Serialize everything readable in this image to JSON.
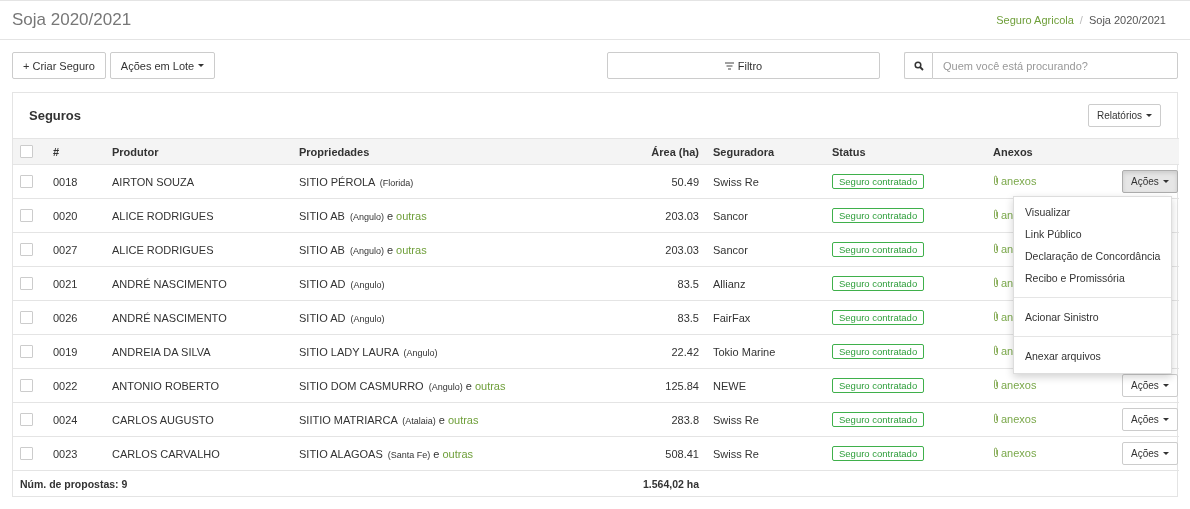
{
  "page_title": "Soja 2020/2021",
  "breadcrumb": [
    {
      "label": "Seguro Agricola",
      "link": true
    },
    {
      "label": "Soja 2020/2021",
      "link": false
    }
  ],
  "breadcrumb_separator": "/",
  "toolbar": {
    "create_button": "+ Criar Seguro",
    "batch_button": "Ações em Lote",
    "filter_button": "Filtro",
    "search": {
      "placeholder": "Quem você está procurando?"
    }
  },
  "panel": {
    "title": "Seguros",
    "reports_button": "Relatórios"
  },
  "table": {
    "select_all_checked": false,
    "columns": [
      "#",
      "Produtor",
      "Propriedades",
      "Área (ha)",
      "Seguradora",
      "Status",
      "Anexos"
    ],
    "rows": [
      {
        "checked": false,
        "id": "0018",
        "producer": "AIRTON SOUZA",
        "property": {
          "name": "SITIO PÉROLA",
          "location": "(Florida)"
        },
        "area": "50.49",
        "insurer": "Swiss Re",
        "status": "Seguro contratado",
        "attachments": "anexos",
        "actions": "Ações",
        "menu_open": true
      },
      {
        "checked": false,
        "id": "0020",
        "producer": "ALICE RODRIGUES",
        "property": {
          "name": "SITIO AB",
          "location": "(Angulo)",
          "joiner": "e",
          "more": "outras"
        },
        "area": "203.03",
        "insurer": "Sancor",
        "status": "Seguro contratado",
        "attachments": "an"
      },
      {
        "checked": false,
        "id": "0027",
        "producer": "ALICE RODRIGUES",
        "property": {
          "name": "SITIO AB",
          "location": "(Angulo)",
          "joiner": "e",
          "more": "outras"
        },
        "area": "203.03",
        "insurer": "Sancor",
        "status": "Seguro contratado",
        "attachments": "an"
      },
      {
        "checked": false,
        "id": "0021",
        "producer": "ANDRÉ NASCIMENTO",
        "property": {
          "name": "SITIO AD",
          "location": "(Angulo)"
        },
        "area": "83.5",
        "insurer": "Allianz",
        "status": "Seguro contratado",
        "attachments": "an"
      },
      {
        "checked": false,
        "id": "0026",
        "producer": "ANDRÉ NASCIMENTO",
        "property": {
          "name": "SITIO AD",
          "location": "(Angulo)"
        },
        "area": "83.5",
        "insurer": "FairFax",
        "status": "Seguro contratado",
        "attachments": "an"
      },
      {
        "checked": false,
        "id": "0019",
        "producer": "ANDREIA DA SILVA",
        "property": {
          "name": "SITIO LADY LAURA",
          "location": "(Angulo)"
        },
        "area": "22.42",
        "insurer": "Tokio Marine",
        "status": "Seguro contratado",
        "attachments": "an"
      },
      {
        "checked": false,
        "id": "0022",
        "producer": "ANTONIO ROBERTO",
        "property": {
          "name": "SITIO DOM CASMURRO",
          "location": "(Angulo)",
          "joiner": "e",
          "more": "outras"
        },
        "area": "125.84",
        "insurer": "NEWE",
        "status": "Seguro contratado",
        "attachments": "anexos",
        "actions": "Ações",
        "menu_open": false
      },
      {
        "checked": false,
        "id": "0024",
        "producer": "CARLOS AUGUSTO",
        "property": {
          "name": "SIITIO MATRIARCA",
          "location": "(Atalaia)",
          "joiner": "e",
          "more": "outras"
        },
        "area": "283.8",
        "insurer": "Swiss Re",
        "status": "Seguro contratado",
        "attachments": "anexos",
        "actions": "Ações",
        "menu_open": false
      },
      {
        "checked": false,
        "id": "0023",
        "producer": "CARLOS CARVALHO",
        "property": {
          "name": "SITIO ALAGOAS",
          "location": "(Santa Fe)",
          "joiner": "e",
          "more": "outras"
        },
        "area": "508.41",
        "insurer": "Swiss Re",
        "status": "Seguro contratado",
        "attachments": "anexos",
        "actions": "Ações",
        "menu_open": false
      }
    ],
    "footer": {
      "count": "Núm. de propostas: 9",
      "total_area": "1.564,02 ha"
    }
  },
  "actions_menu": [
    [
      "Visualizar",
      "Link Público",
      "Declaração de Concordância",
      "Recibo e Promissória"
    ],
    [
      "Acionar Sinistro"
    ],
    [
      "Anexar arquivos"
    ]
  ]
}
